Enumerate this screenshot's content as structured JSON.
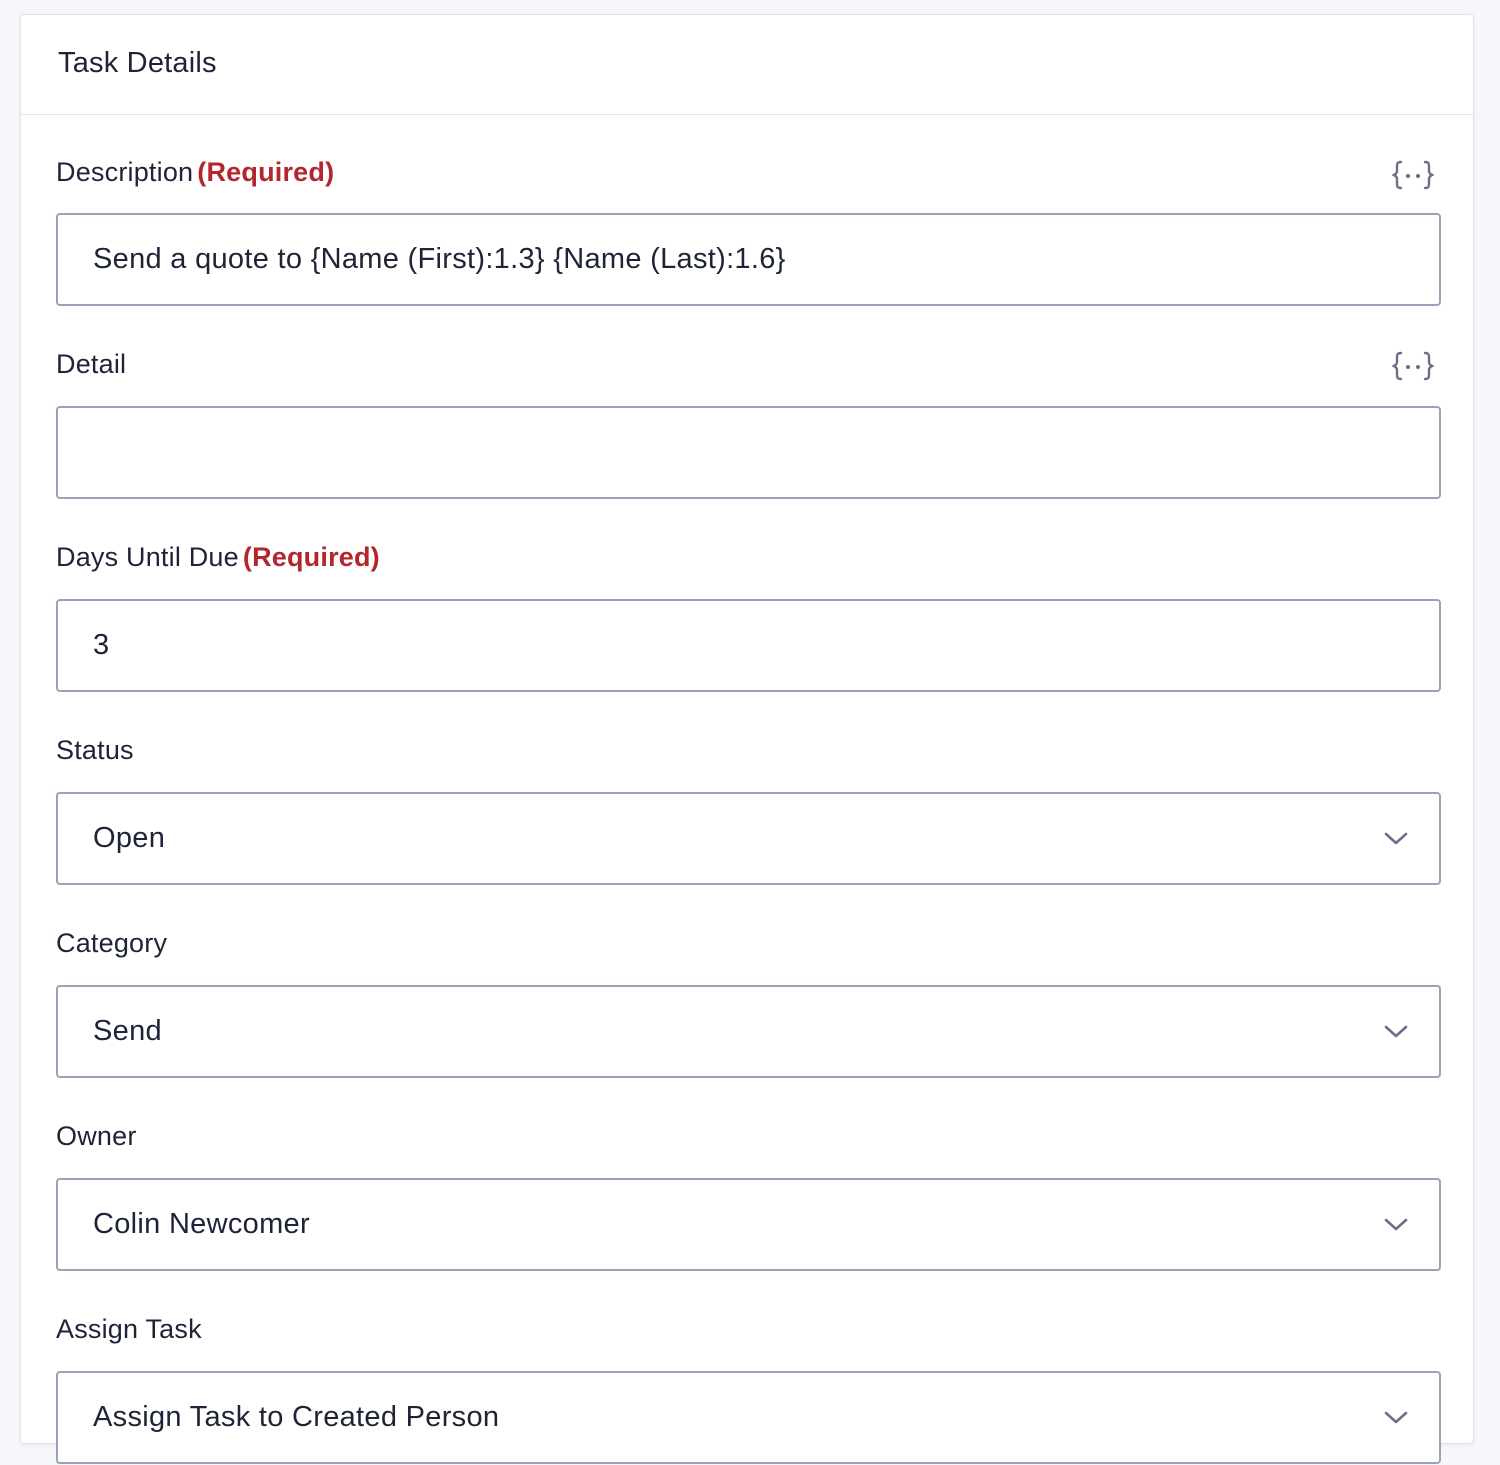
{
  "panel": {
    "title": "Task Details"
  },
  "fields": {
    "description": {
      "label": "Description",
      "required_label": "(Required)",
      "value": "Send a quote to {Name (First):1.3} {Name (Last):1.6}",
      "merge_tag_icon": "merge-tag-icon"
    },
    "detail": {
      "label": "Detail",
      "value": "",
      "merge_tag_icon": "merge-tag-icon"
    },
    "days_until_due": {
      "label": "Days Until Due",
      "required_label": "(Required)",
      "value": "3"
    },
    "status": {
      "label": "Status",
      "selected": "Open"
    },
    "category": {
      "label": "Category",
      "selected": "Send"
    },
    "owner": {
      "label": "Owner",
      "selected": "Colin Newcomer"
    },
    "assign_task": {
      "label": "Assign Task",
      "selected": "Assign Task to Created Person"
    }
  },
  "colors": {
    "required": "#b3262e",
    "border": "#9ba1b8",
    "text": "#1f2338",
    "icon": "#6b7089"
  }
}
